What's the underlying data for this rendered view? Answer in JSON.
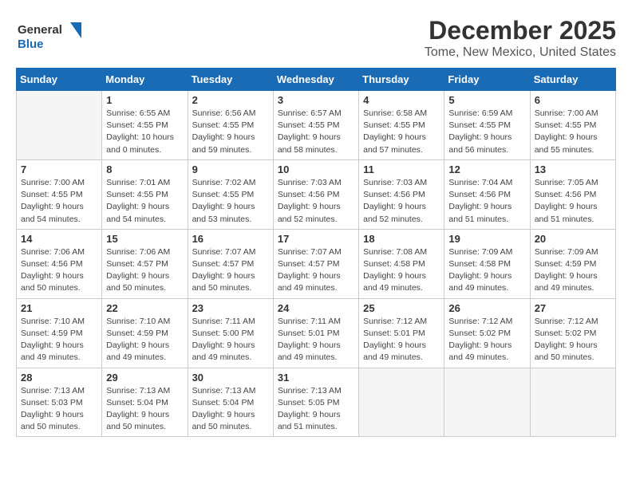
{
  "header": {
    "logo_general": "General",
    "logo_blue": "Blue",
    "month": "December 2025",
    "location": "Tome, New Mexico, United States"
  },
  "calendar": {
    "days_of_week": [
      "Sunday",
      "Monday",
      "Tuesday",
      "Wednesday",
      "Thursday",
      "Friday",
      "Saturday"
    ],
    "weeks": [
      [
        {
          "day": "",
          "info": ""
        },
        {
          "day": "1",
          "info": "Sunrise: 6:55 AM\nSunset: 4:55 PM\nDaylight: 10 hours\nand 0 minutes."
        },
        {
          "day": "2",
          "info": "Sunrise: 6:56 AM\nSunset: 4:55 PM\nDaylight: 9 hours\nand 59 minutes."
        },
        {
          "day": "3",
          "info": "Sunrise: 6:57 AM\nSunset: 4:55 PM\nDaylight: 9 hours\nand 58 minutes."
        },
        {
          "day": "4",
          "info": "Sunrise: 6:58 AM\nSunset: 4:55 PM\nDaylight: 9 hours\nand 57 minutes."
        },
        {
          "day": "5",
          "info": "Sunrise: 6:59 AM\nSunset: 4:55 PM\nDaylight: 9 hours\nand 56 minutes."
        },
        {
          "day": "6",
          "info": "Sunrise: 7:00 AM\nSunset: 4:55 PM\nDaylight: 9 hours\nand 55 minutes."
        }
      ],
      [
        {
          "day": "7",
          "info": "Sunrise: 7:00 AM\nSunset: 4:55 PM\nDaylight: 9 hours\nand 54 minutes."
        },
        {
          "day": "8",
          "info": "Sunrise: 7:01 AM\nSunset: 4:55 PM\nDaylight: 9 hours\nand 54 minutes."
        },
        {
          "day": "9",
          "info": "Sunrise: 7:02 AM\nSunset: 4:55 PM\nDaylight: 9 hours\nand 53 minutes."
        },
        {
          "day": "10",
          "info": "Sunrise: 7:03 AM\nSunset: 4:56 PM\nDaylight: 9 hours\nand 52 minutes."
        },
        {
          "day": "11",
          "info": "Sunrise: 7:03 AM\nSunset: 4:56 PM\nDaylight: 9 hours\nand 52 minutes."
        },
        {
          "day": "12",
          "info": "Sunrise: 7:04 AM\nSunset: 4:56 PM\nDaylight: 9 hours\nand 51 minutes."
        },
        {
          "day": "13",
          "info": "Sunrise: 7:05 AM\nSunset: 4:56 PM\nDaylight: 9 hours\nand 51 minutes."
        }
      ],
      [
        {
          "day": "14",
          "info": "Sunrise: 7:06 AM\nSunset: 4:56 PM\nDaylight: 9 hours\nand 50 minutes."
        },
        {
          "day": "15",
          "info": "Sunrise: 7:06 AM\nSunset: 4:57 PM\nDaylight: 9 hours\nand 50 minutes."
        },
        {
          "day": "16",
          "info": "Sunrise: 7:07 AM\nSunset: 4:57 PM\nDaylight: 9 hours\nand 50 minutes."
        },
        {
          "day": "17",
          "info": "Sunrise: 7:07 AM\nSunset: 4:57 PM\nDaylight: 9 hours\nand 49 minutes."
        },
        {
          "day": "18",
          "info": "Sunrise: 7:08 AM\nSunset: 4:58 PM\nDaylight: 9 hours\nand 49 minutes."
        },
        {
          "day": "19",
          "info": "Sunrise: 7:09 AM\nSunset: 4:58 PM\nDaylight: 9 hours\nand 49 minutes."
        },
        {
          "day": "20",
          "info": "Sunrise: 7:09 AM\nSunset: 4:59 PM\nDaylight: 9 hours\nand 49 minutes."
        }
      ],
      [
        {
          "day": "21",
          "info": "Sunrise: 7:10 AM\nSunset: 4:59 PM\nDaylight: 9 hours\nand 49 minutes."
        },
        {
          "day": "22",
          "info": "Sunrise: 7:10 AM\nSunset: 4:59 PM\nDaylight: 9 hours\nand 49 minutes."
        },
        {
          "day": "23",
          "info": "Sunrise: 7:11 AM\nSunset: 5:00 PM\nDaylight: 9 hours\nand 49 minutes."
        },
        {
          "day": "24",
          "info": "Sunrise: 7:11 AM\nSunset: 5:01 PM\nDaylight: 9 hours\nand 49 minutes."
        },
        {
          "day": "25",
          "info": "Sunrise: 7:12 AM\nSunset: 5:01 PM\nDaylight: 9 hours\nand 49 minutes."
        },
        {
          "day": "26",
          "info": "Sunrise: 7:12 AM\nSunset: 5:02 PM\nDaylight: 9 hours\nand 49 minutes."
        },
        {
          "day": "27",
          "info": "Sunrise: 7:12 AM\nSunset: 5:02 PM\nDaylight: 9 hours\nand 50 minutes."
        }
      ],
      [
        {
          "day": "28",
          "info": "Sunrise: 7:13 AM\nSunset: 5:03 PM\nDaylight: 9 hours\nand 50 minutes."
        },
        {
          "day": "29",
          "info": "Sunrise: 7:13 AM\nSunset: 5:04 PM\nDaylight: 9 hours\nand 50 minutes."
        },
        {
          "day": "30",
          "info": "Sunrise: 7:13 AM\nSunset: 5:04 PM\nDaylight: 9 hours\nand 50 minutes."
        },
        {
          "day": "31",
          "info": "Sunrise: 7:13 AM\nSunset: 5:05 PM\nDaylight: 9 hours\nand 51 minutes."
        },
        {
          "day": "",
          "info": ""
        },
        {
          "day": "",
          "info": ""
        },
        {
          "day": "",
          "info": ""
        }
      ]
    ]
  }
}
